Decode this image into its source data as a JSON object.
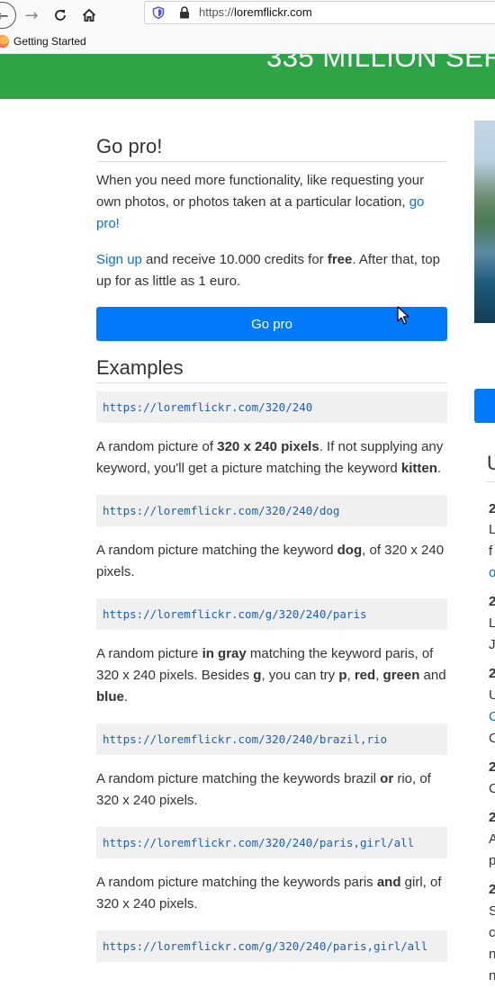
{
  "browser": {
    "url_scheme": "https://",
    "url_host": "loremflickr.com",
    "bookmark_label": "Getting Started"
  },
  "banner": {
    "title": "335 MILLION SER"
  },
  "gopro": {
    "heading": "Go pro!",
    "para1_text": "When you need more functionality, like requesting your own photos, or photos taken at a particular location,",
    "para1_link": "go pro!",
    "signup_link": "Sign up",
    "para2_a": "and receive 10.000 credits for",
    "para2_bold": "free",
    "para2_b": ". After that, top up for as little as 1 euro.",
    "button_label": "Go pro"
  },
  "examples": {
    "heading": "Examples",
    "items": [
      {
        "url": "https://loremflickr.com/320/240",
        "desc": [
          {
            "t": "A random picture of "
          },
          {
            "t": "320 x 240 pixels",
            "b": true
          },
          {
            "t": ". If not supplying any keyword, you'll get a picture matching the keyword "
          },
          {
            "t": "kitten",
            "b": true
          },
          {
            "t": "."
          }
        ]
      },
      {
        "url": "https://loremflickr.com/320/240/dog",
        "desc": [
          {
            "t": "A random picture matching the keyword "
          },
          {
            "t": "dog",
            "b": true
          },
          {
            "t": ", of 320 x 240 pixels."
          }
        ]
      },
      {
        "url": "https://loremflickr.com/g/320/240/paris",
        "desc": [
          {
            "t": "A random picture "
          },
          {
            "t": "in gray",
            "b": true
          },
          {
            "t": " matching the keyword paris, of 320 x 240 pixels. Besides "
          },
          {
            "t": "g",
            "b": true
          },
          {
            "t": ", you can try "
          },
          {
            "t": "p",
            "b": true
          },
          {
            "t": ", "
          },
          {
            "t": "red",
            "b": true
          },
          {
            "t": ", "
          },
          {
            "t": "green",
            "b": true
          },
          {
            "t": " and "
          },
          {
            "t": "blue",
            "b": true
          },
          {
            "t": "."
          }
        ]
      },
      {
        "url": "https://loremflickr.com/320/240/brazil,rio",
        "desc": [
          {
            "t": "A random picture matching the keywords brazil "
          },
          {
            "t": "or",
            "b": true
          },
          {
            "t": " rio, of 320 x 240 pixels."
          }
        ]
      },
      {
        "url": "https://loremflickr.com/320/240/paris,girl/all",
        "desc": [
          {
            "t": "A random picture matching the keywords paris "
          },
          {
            "t": "and",
            "b": true
          },
          {
            "t": " girl, of 320 x 240 pixels."
          }
        ]
      },
      {
        "url": "https://loremflickr.com/g/320/240/paris,girl/all",
        "desc": []
      }
    ]
  },
  "sidebar": {
    "heading_fragment": "U",
    "chars": [
      "2",
      "L",
      "f",
      "o",
      "2",
      "L",
      "J",
      "2",
      "U",
      "C",
      "C",
      "2",
      "C",
      "2",
      "A",
      "p",
      "2",
      "S",
      "c",
      "n",
      "n"
    ]
  },
  "colors": {
    "banner_green": "#2ea447",
    "button_blue": "#0079fa",
    "link_blue": "#0a6fd6",
    "code_bg": "#f0f0f0"
  },
  "icons": [
    "back-icon",
    "forward-icon",
    "reload-icon",
    "home-icon",
    "shield-icon",
    "lock-icon",
    "firefox-icon",
    "mouse-cursor-icon"
  ]
}
